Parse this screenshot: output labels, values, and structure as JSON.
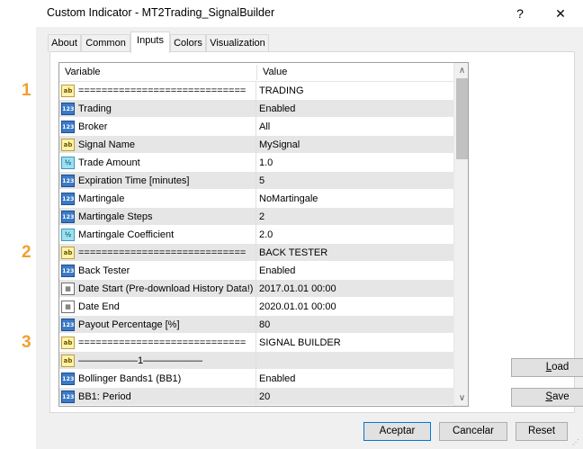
{
  "window": {
    "title": "Custom Indicator - MT2Trading_SignalBuilder",
    "help_glyph": "?",
    "close_glyph": "✕"
  },
  "tabs": [
    {
      "label": "About"
    },
    {
      "label": "Common"
    },
    {
      "label": "Inputs"
    },
    {
      "label": "Colors"
    },
    {
      "label": "Visualization"
    }
  ],
  "active_tab": "Inputs",
  "grid": {
    "headers": {
      "variable": "Variable",
      "value": "Value"
    },
    "rows": [
      {
        "icon": "ab",
        "variable": "=============================",
        "value": "TRADING"
      },
      {
        "icon": "123",
        "variable": "Trading",
        "value": "Enabled"
      },
      {
        "icon": "123",
        "variable": "Broker",
        "value": "All"
      },
      {
        "icon": "ab",
        "variable": "Signal Name",
        "value": "MySignal"
      },
      {
        "icon": "½",
        "variable": "Trade Amount",
        "value": "1.0"
      },
      {
        "icon": "123",
        "variable": "Expiration Time [minutes]",
        "value": "5"
      },
      {
        "icon": "123",
        "variable": "Martingale",
        "value": "NoMartingale"
      },
      {
        "icon": "123",
        "variable": "Martingale Steps",
        "value": "2"
      },
      {
        "icon": "½",
        "variable": "Martingale Coefficient",
        "value": "2.0"
      },
      {
        "icon": "ab",
        "variable": "=============================",
        "value": "BACK TESTER"
      },
      {
        "icon": "123",
        "variable": "Back Tester",
        "value": "Enabled"
      },
      {
        "icon": "date",
        "variable": "Date Start (Pre-download History Data!)",
        "value": "2017.01.01 00:00"
      },
      {
        "icon": "date",
        "variable": "Date End",
        "value": "2020.01.01 00:00"
      },
      {
        "icon": "123",
        "variable": "Payout Percentage [%]",
        "value": "80"
      },
      {
        "icon": "ab",
        "variable": "=============================",
        "value": "SIGNAL BUILDER"
      },
      {
        "icon": "ab",
        "variable": "——————1——————",
        "value": ""
      },
      {
        "icon": "123",
        "variable": "Bollinger Bands1 (BB1)",
        "value": "Enabled"
      },
      {
        "icon": "123",
        "variable": "BB1: Period",
        "value": "20"
      }
    ]
  },
  "markers": [
    "1",
    "2",
    "3"
  ],
  "buttons": {
    "load": "Load",
    "save": "Save",
    "accept": "Aceptar",
    "cancel": "Cancelar",
    "reset": "Reset"
  },
  "colors": {
    "marker": "#f0a030",
    "accent": "#0078d7"
  }
}
